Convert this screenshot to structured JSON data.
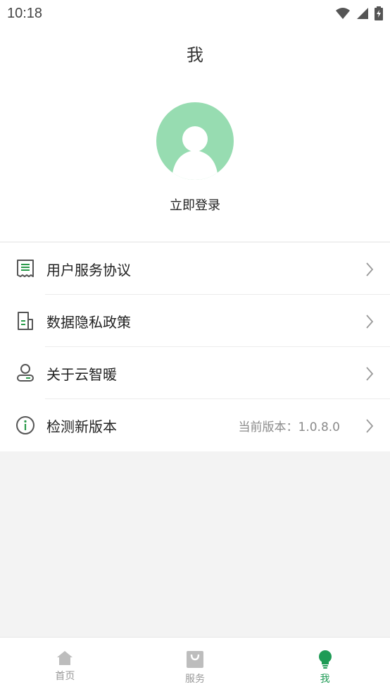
{
  "status_bar": {
    "time": "10:18"
  },
  "header": {
    "title": "我"
  },
  "profile": {
    "login_label": "立即登录"
  },
  "menu": {
    "items": [
      {
        "label": "用户服务协议",
        "value": ""
      },
      {
        "label": "数据隐私政策",
        "value": ""
      },
      {
        "label": "关于云智暖",
        "value": ""
      },
      {
        "label": "检测新版本",
        "value": "当前版本：1.0.8.0"
      }
    ]
  },
  "bottom_nav": {
    "items": [
      {
        "label": "首页",
        "icon": "home-icon"
      },
      {
        "label": "服务",
        "icon": "bag-icon"
      },
      {
        "label": "我",
        "icon": "bulb-icon"
      }
    ]
  },
  "colors": {
    "accent": "#1e9b55",
    "avatar_bg": "#97dcb1",
    "inactive": "#999999"
  }
}
